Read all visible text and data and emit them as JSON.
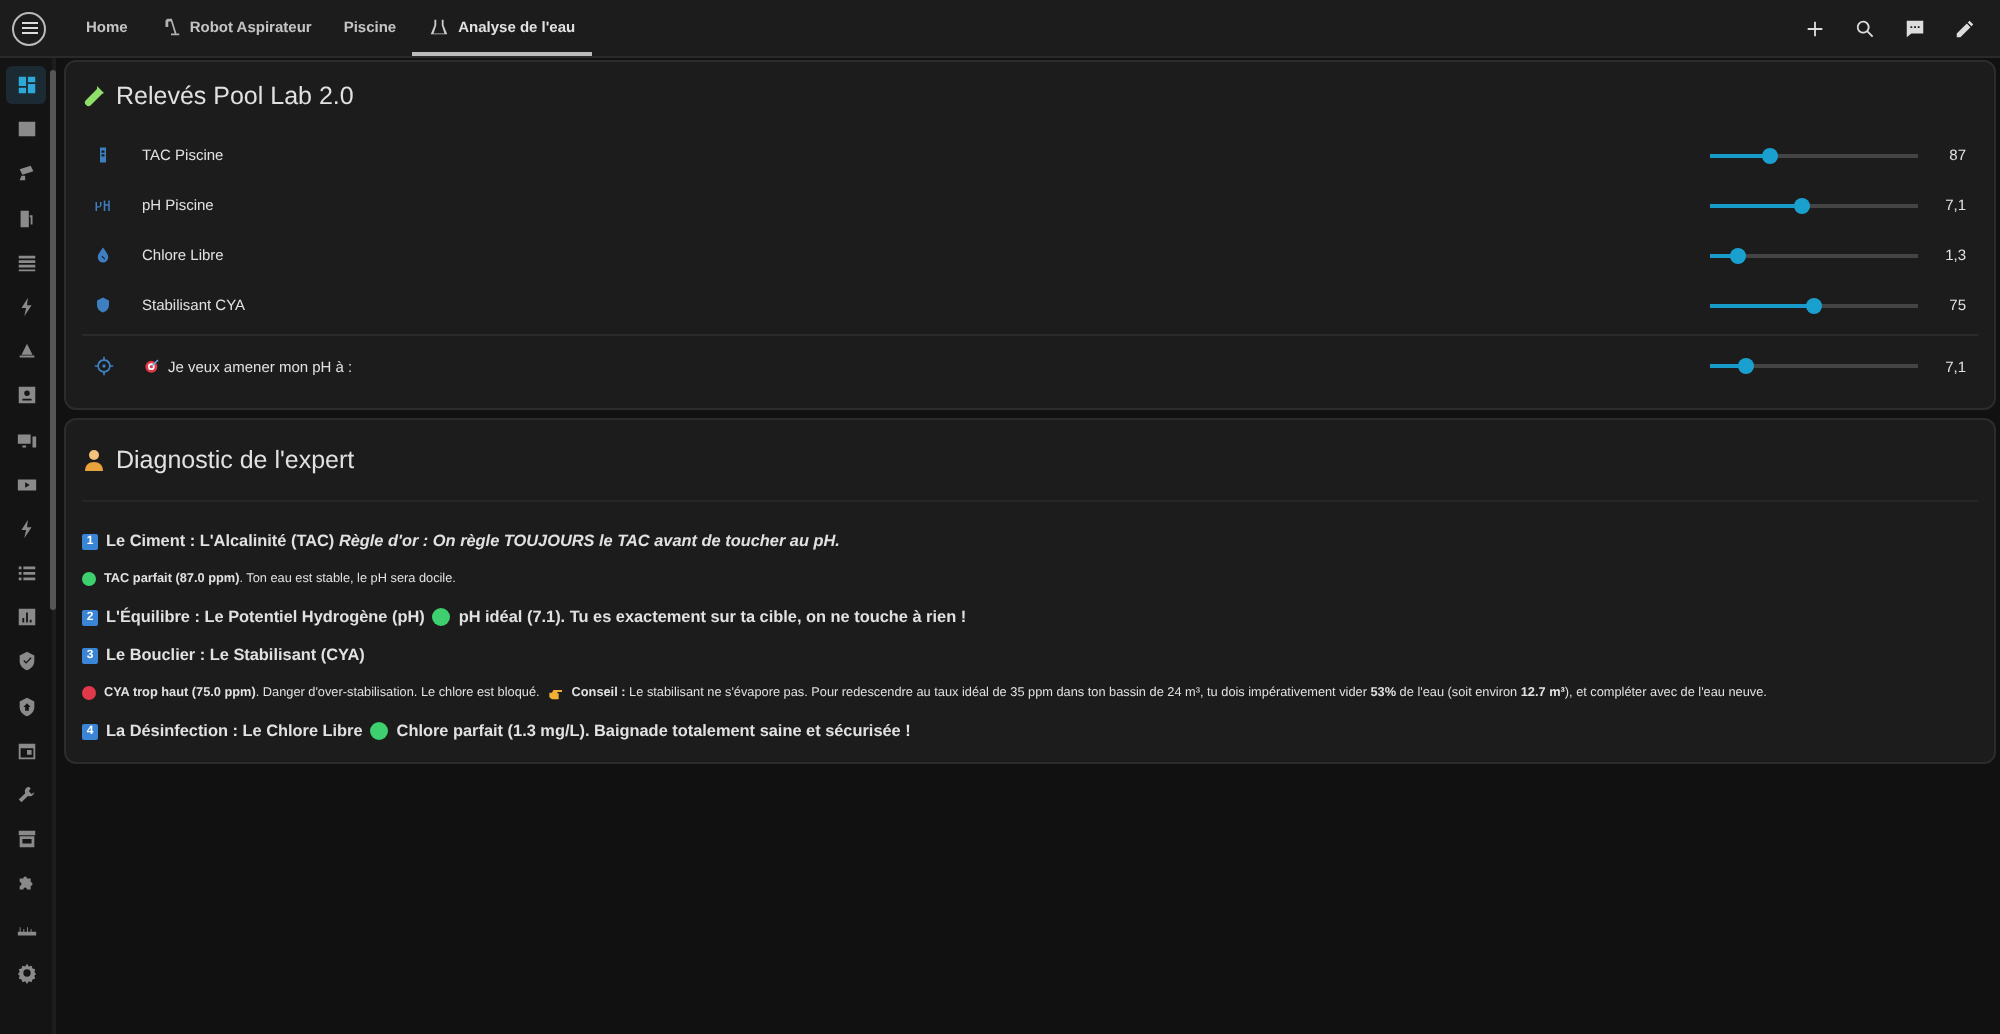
{
  "tabs": [
    {
      "label": "Home",
      "selected": false
    },
    {
      "label": "Robot Aspirateur",
      "selected": false
    },
    {
      "label": "Piscine",
      "selected": false
    },
    {
      "label": "Analyse de l'eau",
      "selected": true
    }
  ],
  "sidebar": {
    "items": [
      {
        "selected": true
      },
      {
        "selected": false
      },
      {
        "selected": false
      },
      {
        "selected": false
      },
      {
        "selected": false
      },
      {
        "selected": false
      },
      {
        "selected": false
      },
      {
        "selected": false
      },
      {
        "selected": false
      },
      {
        "selected": false
      },
      {
        "selected": false
      },
      {
        "selected": false
      },
      {
        "selected": false
      },
      {
        "selected": false
      },
      {
        "selected": false
      },
      {
        "selected": false
      },
      {
        "selected": false
      },
      {
        "selected": false
      },
      {
        "selected": false
      },
      {
        "selected": false
      },
      {
        "selected": false
      }
    ]
  },
  "readings_card": {
    "title": "Relevés Pool Lab 2.0",
    "rows": [
      {
        "name": "TAC Piscine",
        "level": 0.29,
        "reading": "87"
      },
      {
        "name": "pH Piscine",
        "level": 0.44,
        "reading": "7,1"
      },
      {
        "name": "Chlore Libre",
        "level": 0.13,
        "reading": "1,3"
      },
      {
        "name": "Stabilisant CYA",
        "level": 0.5,
        "reading": "75"
      }
    ],
    "target": {
      "name": "Je veux amener mon pH à :",
      "level": 0.17,
      "reading": "7,1"
    }
  },
  "diagnostic_card": {
    "title": "Diagnostic de l'expert",
    "lines": [
      {
        "kind": "heading",
        "number": "1",
        "text": "Le Ciment : L'Alcalinité (TAC) *Règle d'or : On règle TOUJOURS le TAC avant de toucher au pH.*"
      },
      {
        "kind": "status",
        "color": "#3ecf6e",
        "text": "**TAC parfait (87.0 ppm)**. Ton eau est stable, le pH sera docile."
      },
      {
        "kind": "heading",
        "number": "2",
        "text": "L'Équilibre : Le Potentiel Hydrogène (pH)",
        "result": {
          "color": "#3ecf6e",
          "text": "pH idéal (7.1). Tu es exactement sur ta cible, on ne touche à rien !"
        }
      },
      {
        "kind": "heading",
        "number": "3",
        "text": "Le Bouclier : Le Stabilisant (CYA)"
      },
      {
        "kind": "status",
        "color": "#e0394a",
        "text": "**CYA trop haut (75.0 ppm)**. Danger d'over-stabilisation. Le chlore est bloqué.",
        "advice": "**Conseil :** Le stabilisant ne s'évapore pas. Pour redescendre au taux idéal de 35 ppm dans ton bassin de 24 m³, tu dois impérativement vider **53%** de l'eau (soit environ **12.7 m³**), et compléter avec de l'eau neuve."
      },
      {
        "kind": "heading",
        "number": "4",
        "text": "La Désinfection : Le Chlore Libre",
        "result": {
          "color": "#3ecf6e",
          "text": "Chlore parfait (1.3 mg/L). Baignade totalement saine et sécurisée !"
        }
      }
    ]
  }
}
